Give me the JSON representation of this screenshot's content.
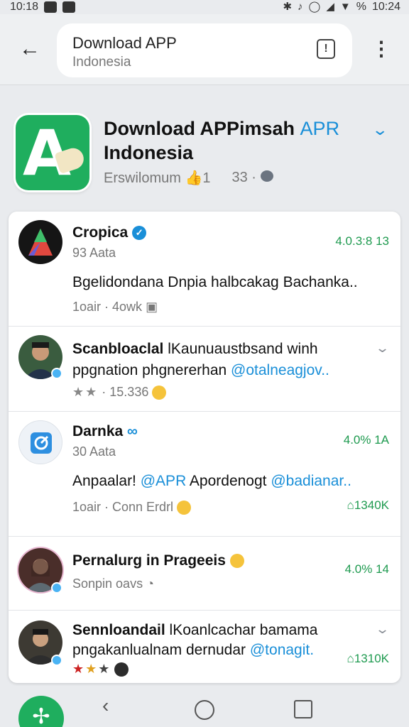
{
  "status_bar": {
    "time_left": "10:18",
    "time_right": "10:24",
    "battery_text": "%"
  },
  "search": {
    "title": "Download APP",
    "subtitle": "Indonesia"
  },
  "app": {
    "title_main": "Download APPimsah ",
    "title_accent": "APR",
    "title_line2": "Indonesia",
    "developer": "Erswilomum",
    "likes": "1",
    "comments": "33"
  },
  "posts": [
    {
      "name": "Cropica",
      "handle": "93 Aata",
      "text": "Bgelidondana Dnpia halbcakag Bachanka..",
      "meta": "1oair · 4owk",
      "stat": "4.0.3:8 13"
    },
    {
      "name_bold": "Scanbloaclal",
      "name_rest": " lKaunuaustbsand winh",
      "text_plain": "ppgnation phgnererhan ",
      "mention": "@otalneagjov..",
      "meta": "15.336"
    },
    {
      "name": "Darnka",
      "handle": "30 Aata",
      "text_1": "Anpaalar! ",
      "mention_1": "@APR",
      "text_2": " Apordenogt ",
      "mention_2": "@badianar..",
      "meta": "1oair · Conn Erdrl",
      "stat": "4.0% 1A",
      "count": "1340K"
    },
    {
      "name": "Pernalurg in Prageeis",
      "handle": "Sonpin oavs",
      "stat": "4.0% 14"
    },
    {
      "name_bold": "Sennloandail",
      "name_rest": " lKoanlcachar bamama",
      "text_plain": "pngakanlualnam dernudar ",
      "mention": "@tonagit.",
      "count": "1310K"
    }
  ],
  "colors": {
    "accent": "#1a8fd8",
    "brand_green": "#1fae5e",
    "stat_green": "#1e9a4f"
  },
  "icons": [
    "back-arrow-icon",
    "info-icon",
    "more-vert-icon",
    "chevron-down-icon",
    "verified-icon",
    "nav-back-icon",
    "nav-home-icon",
    "nav-recent-icon"
  ]
}
